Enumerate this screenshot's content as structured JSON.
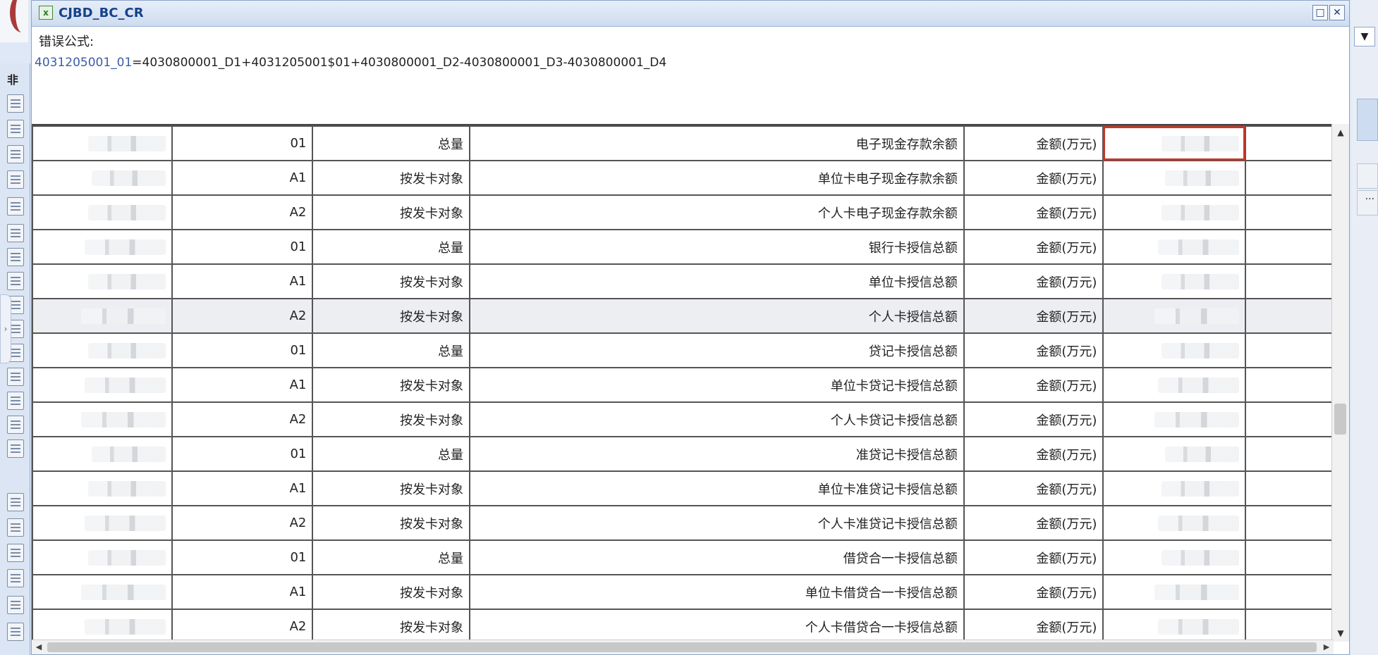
{
  "dialog": {
    "title": "CJBD_BC_CR",
    "maximize_glyph": "□",
    "close_glyph": "✕"
  },
  "error_label": "错误公式:",
  "formula": {
    "lhs": "4031205001_01",
    "rhs": "=4030800001_D1+4031205001$01+4030800001_D2-4030800001_D3-4030800001_D4"
  },
  "background": {
    "sidebar_title": "非",
    "dropdown_glyph": "▼",
    "panel_text": "..."
  },
  "rows": [
    {
      "code": "4031205001",
      "col2": "01",
      "col3": "总量",
      "col4": "电子现金存款余额",
      "col5": "金额(万元)",
      "value": ""
    },
    {
      "code": "4031205001",
      "col2": "A1",
      "col3": "按发卡对象",
      "col4": "单位卡电子现金存款余额",
      "col5": "金额(万元)",
      "value": ""
    },
    {
      "code": "4031205001",
      "col2": "A2",
      "col3": "按发卡对象",
      "col4": "个人卡电子现金存款余额",
      "col5": "金额(万元)",
      "value": ""
    },
    {
      "code": "4031300001",
      "col2": "01",
      "col3": "总量",
      "col4": "银行卡授信总额",
      "col5": "金额(万元)",
      "value": ""
    },
    {
      "code": "4031300001",
      "col2": "A1",
      "col3": "按发卡对象",
      "col4": "单位卡授信总额",
      "col5": "金额(万元)",
      "value": ""
    },
    {
      "code": "4031300001",
      "col2": "A2",
      "col3": "按发卡对象",
      "col4": "个人卡授信总额",
      "col5": "金额(万元)",
      "value": ""
    },
    {
      "code": "4031301",
      "col2": "01",
      "col3": "总量",
      "col4": "贷记卡授信总额",
      "col5": "金额(万元)",
      "value": ""
    },
    {
      "code": "4031301001",
      "col2": "A1",
      "col3": "按发卡对象",
      "col4": "单位卡贷记卡授信总额",
      "col5": "金额(万元)",
      "value": ""
    },
    {
      "code": "4031301001",
      "col2": "A2",
      "col3": "按发卡对象",
      "col4": "个人卡贷记卡授信总额",
      "col5": "金额(万元)",
      "value": ""
    },
    {
      "code": "4031302001",
      "col2": "01",
      "col3": "总量",
      "col4": "准贷记卡授信总额",
      "col5": "金额(万元)",
      "value": ""
    },
    {
      "code": "4031302001",
      "col2": "A1",
      "col3": "按发卡对象",
      "col4": "单位卡准贷记卡授信总额",
      "col5": "金额(万元)",
      "value": ""
    },
    {
      "code": "4031302001",
      "col2": "A2",
      "col3": "按发卡对象",
      "col4": "个人卡准贷记卡授信总额",
      "col5": "金额(万元)",
      "value": ""
    },
    {
      "code": "4031303001",
      "col2": "01",
      "col3": "总量",
      "col4": "借贷合一卡授信总额",
      "col5": "金额(万元)",
      "value": ""
    },
    {
      "code": "4031303001",
      "col2": "A1",
      "col3": "按发卡对象",
      "col4": "单位卡借贷合一卡授信总额",
      "col5": "金额(万元)",
      "value": ""
    },
    {
      "code": "4031303001",
      "col2": "A2",
      "col3": "按发卡对象",
      "col4": "个人卡借贷合一卡授信总额",
      "col5": "金额(万元)",
      "value": ""
    }
  ],
  "scroll": {
    "up": "▲",
    "down": "▼",
    "left": "◀",
    "right": "▶"
  }
}
